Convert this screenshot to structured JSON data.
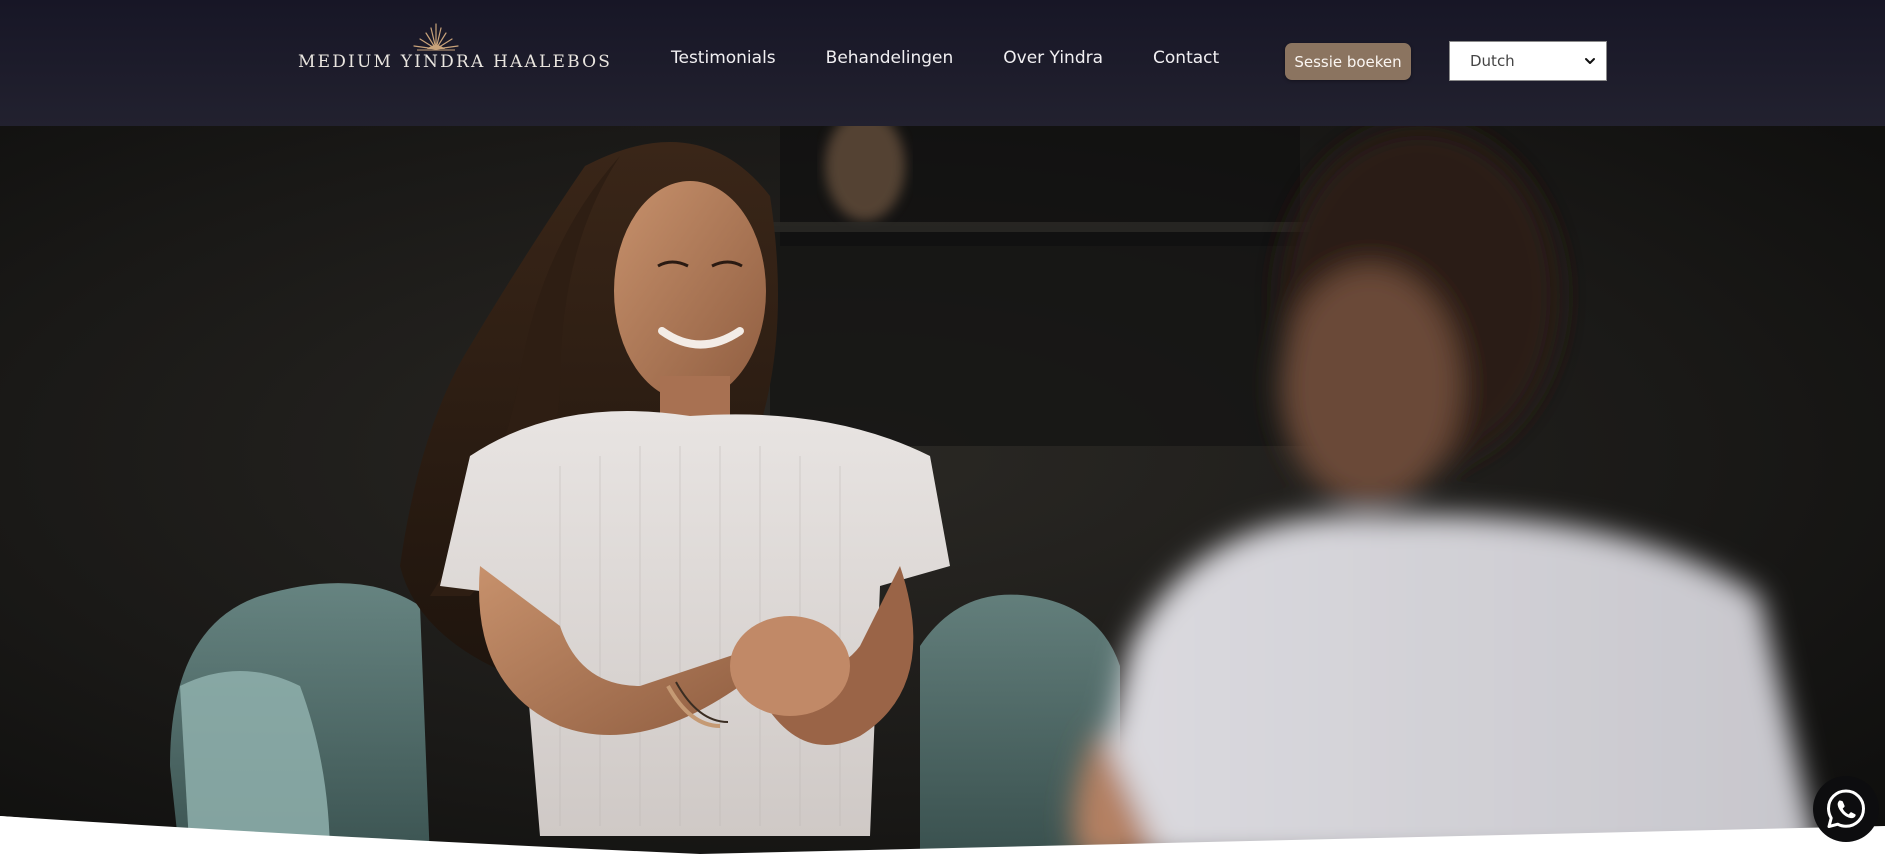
{
  "brand": {
    "name": "MEDIUM YINDRA HAALEBOS",
    "logo_icon": "lotus-icon"
  },
  "nav": {
    "items": [
      {
        "label": "Testimonials"
      },
      {
        "label": "Behandelingen"
      },
      {
        "label": "Over Yindra"
      },
      {
        "label": "Contact"
      }
    ]
  },
  "header": {
    "cta_label": "Sessie boeken",
    "language": {
      "selected": "Dutch",
      "icon": "chevron-down-icon"
    }
  },
  "hero": {
    "image_subject": "hero-photo"
  },
  "floating": {
    "whatsapp_icon": "whatsapp-icon"
  },
  "colors": {
    "header_bg": "#1c1b2b",
    "cta_bg": "#8b7460",
    "cta_text": "#fbf6f2",
    "nav_text": "#f1eff2"
  }
}
